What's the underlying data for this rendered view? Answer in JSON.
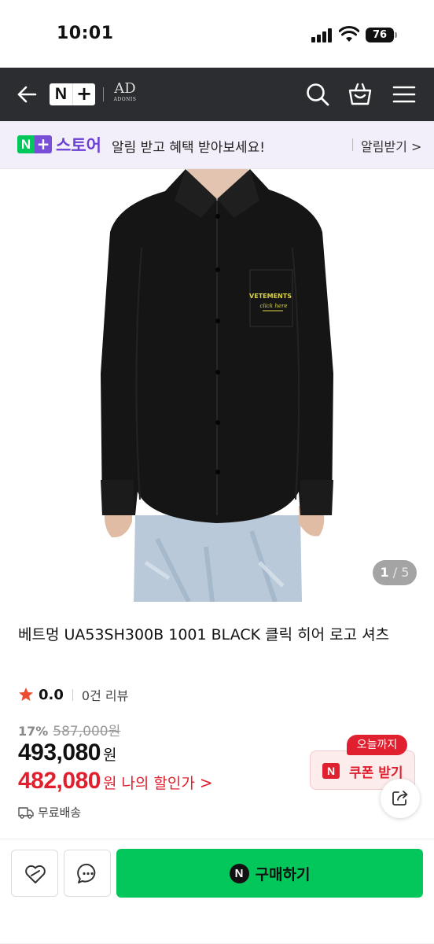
{
  "status": {
    "time": "10:01",
    "battery": "76"
  },
  "nav": {
    "back_icon": "arrow-left-icon",
    "logo_n": "N",
    "logo_plus": "+",
    "brand_mark": "AD",
    "brand_name": "ADONIS",
    "search_icon": "search-icon",
    "cart_icon": "shopping-bag-icon",
    "menu_icon": "hamburger-menu-icon"
  },
  "promo": {
    "logo_n": "N",
    "logo_plus": "+",
    "store": "스토어",
    "text": "알림 받고 혜택 받아보세요!",
    "link": "알림받기 >"
  },
  "gallery": {
    "print_text": "VETEMENTS",
    "print_sub": "click here",
    "current": "1",
    "total": "/ 5"
  },
  "product": {
    "title": "베트멍 UA53SH300B 1001 BLACK 클릭 히어 로고 셔츠",
    "rating": "0.0",
    "reviews": "0건 리뷰",
    "discount_pct": "17%",
    "original_price": "587,000원",
    "price": "493,080",
    "price_unit": "원",
    "my_price": "482,080",
    "my_price_unit": "원",
    "my_price_label": "나의 할인가",
    "my_price_chev": ">",
    "shipping": "무료배송"
  },
  "coupon": {
    "badge": "오늘까지",
    "n": "N",
    "label": "쿠폰 받기"
  },
  "bottom": {
    "buy_logo": "N",
    "buy_label": "구매하기"
  },
  "colors": {
    "naver_green": "#03c75a",
    "store_purple": "#6b3fd4",
    "sale_red": "#e0202e",
    "nav_bg": "#2b2d30"
  }
}
